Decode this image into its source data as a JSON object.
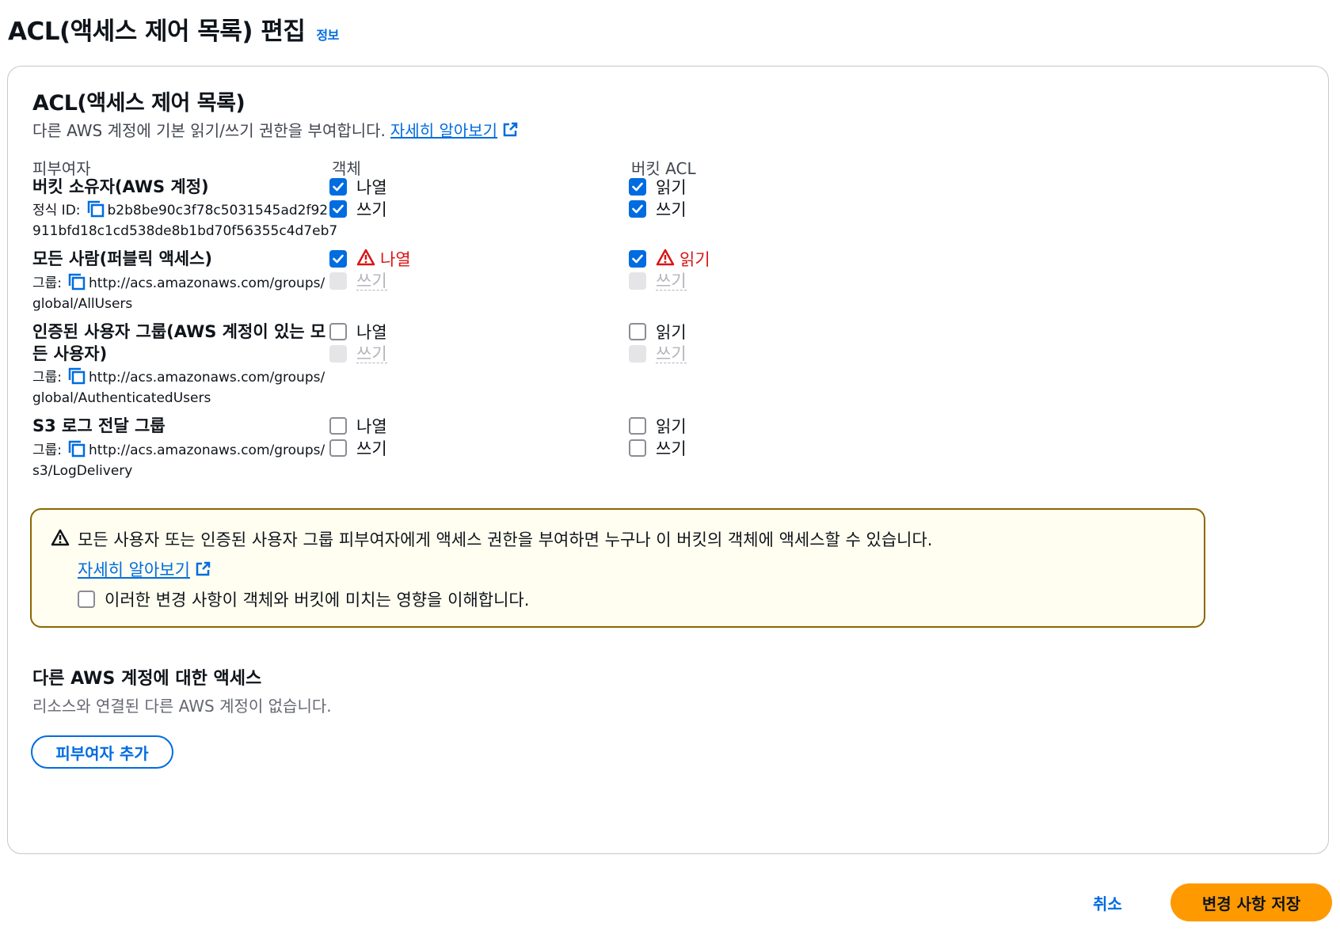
{
  "header": {
    "title": "ACL(액세스 제어 목록) 편집",
    "info": "정보"
  },
  "acl": {
    "title": "ACL(액세스 제어 목록)",
    "description": "다른 AWS 계정에 기본 읽기/쓰기 권한을 부여합니다.",
    "learn_more": "자세히 알아보기",
    "columns": {
      "grantee": "피부여자",
      "object": "객체",
      "bucket_acl": "버킷 ACL"
    },
    "grantees": [
      {
        "name": "버킷 소유자(AWS 계정)",
        "id_label": "정식 ID:",
        "id_value_1": "b2b8be90c3f78c5031545ad2f92",
        "id_value_2": "911bfd18c1cd538de8b1bd70f56355c4d7eb7",
        "object": [
          {
            "label": "나열",
            "state": "checked"
          },
          {
            "label": "쓰기",
            "state": "checked"
          }
        ],
        "bucket": [
          {
            "label": "읽기",
            "state": "checked"
          },
          {
            "label": "쓰기",
            "state": "checked"
          }
        ]
      },
      {
        "name": "모든 사람(퍼블릭 액세스)",
        "id_label": "그룹:",
        "id_value_1": "http://acs.amazonaws.com/groups/",
        "id_value_2": "global/AllUsers",
        "object": [
          {
            "label": "나열",
            "state": "checked-warning"
          },
          {
            "label": "쓰기",
            "state": "disabled"
          }
        ],
        "bucket": [
          {
            "label": "읽기",
            "state": "checked-warning"
          },
          {
            "label": "쓰기",
            "state": "disabled"
          }
        ]
      },
      {
        "name_1": "인증된 사용자 그룹(AWS 계정이 있는 모",
        "name_2": "든 사용자)",
        "id_label": "그룹:",
        "id_value_1": "http://acs.amazonaws.com/groups/",
        "id_value_2": "global/AuthenticatedUsers",
        "object": [
          {
            "label": "나열",
            "state": "unchecked"
          },
          {
            "label": "쓰기",
            "state": "disabled"
          }
        ],
        "bucket": [
          {
            "label": "읽기",
            "state": "unchecked"
          },
          {
            "label": "쓰기",
            "state": "disabled"
          }
        ]
      },
      {
        "name": "S3 로그 전달 그룹",
        "id_label": "그룹:",
        "id_value_1": "http://acs.amazonaws.com/groups/",
        "id_value_2": "s3/LogDelivery",
        "object": [
          {
            "label": "나열",
            "state": "unchecked"
          },
          {
            "label": "쓰기",
            "state": "unchecked"
          }
        ],
        "bucket": [
          {
            "label": "읽기",
            "state": "unchecked"
          },
          {
            "label": "쓰기",
            "state": "unchecked"
          }
        ]
      }
    ]
  },
  "alert": {
    "message": "모든 사용자 또는 인증된 사용자 그룹 피부여자에게 액세스 권한을 부여하면 누구나 이 버킷의 객체에 액세스할 수 있습니다.",
    "learn_more": "자세히 알아보기",
    "acknowledge": "이러한 변경 사항이 객체와 버킷에 미치는 영향을 이해합니다."
  },
  "other_accounts": {
    "title": "다른 AWS 계정에 대한 액세스",
    "description": "리소스와 연결된 다른 AWS 계정이 없습니다.",
    "add_button": "피부여자 추가"
  },
  "footer": {
    "cancel": "취소",
    "save": "변경 사항 저장"
  },
  "colors": {
    "accent": "#006ce0",
    "primary_button": "#ff9900",
    "warning": "#d91515",
    "alert_border": "#8d6605"
  }
}
